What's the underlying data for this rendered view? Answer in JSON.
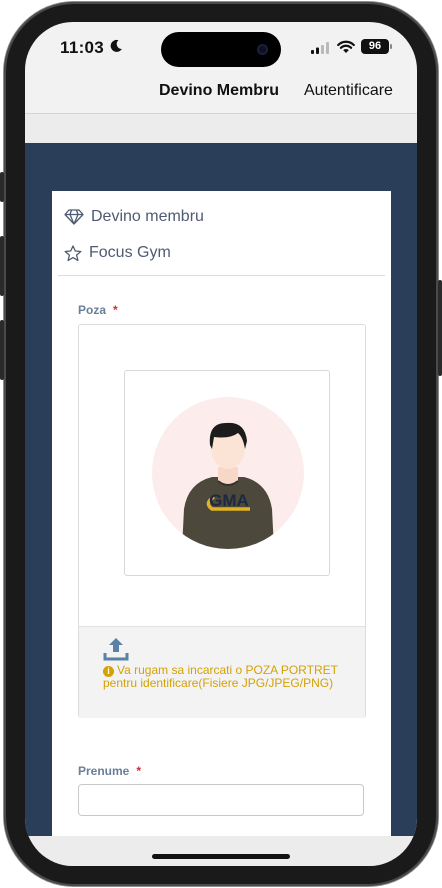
{
  "status_bar": {
    "time": "11:03",
    "battery": "96"
  },
  "nav": {
    "join_label": "Devino Membru",
    "login_label": "Autentificare"
  },
  "breadcrumb": {
    "item1": "Devino membru",
    "item2": "Focus Gym"
  },
  "form": {
    "photo_label": "Poza",
    "required_mark": "*",
    "avatar_logo_text": "GMA",
    "upload_hint": "Va rugam sa incarcati o POZA PORTRET pentru identificare(Fisiere JPG/JPEG/PNG)",
    "first_name_label": "Prenume",
    "first_name_value": ""
  },
  "colors": {
    "accent_dark": "#2b3e59",
    "warning": "#d4a106",
    "required": "#d22d2d"
  },
  "icons": [
    "moon-icon",
    "signal-icon",
    "wifi-icon",
    "battery-icon",
    "diamond-icon",
    "star-icon",
    "upload-icon",
    "info-icon"
  ]
}
